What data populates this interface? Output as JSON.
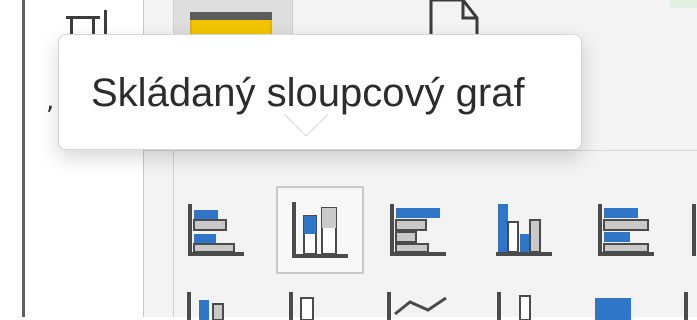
{
  "tooltip": {
    "label": "Skládaný sloupcový graf"
  },
  "gallery": {
    "row1": [
      {
        "icon": "clustered-bar-chart-icon",
        "selected": false
      },
      {
        "icon": "stacked-column-chart-icon",
        "selected": true
      },
      {
        "icon": "stacked-bar-chart-icon",
        "selected": false
      },
      {
        "icon": "clustered-column-chart-icon",
        "selected": false
      },
      {
        "icon": "100-percent-stacked-bar-chart-icon",
        "selected": false
      },
      {
        "icon": "100-percent-stacked-column-chart-icon",
        "selected": false
      }
    ]
  },
  "colors": {
    "accent_blue": "#2f76c9",
    "fill_gray": "#c9c9c9",
    "dark_gray": "#4b4b4b",
    "ribbon_bg": "#f3f3f3",
    "yellow": "#f2c400"
  }
}
